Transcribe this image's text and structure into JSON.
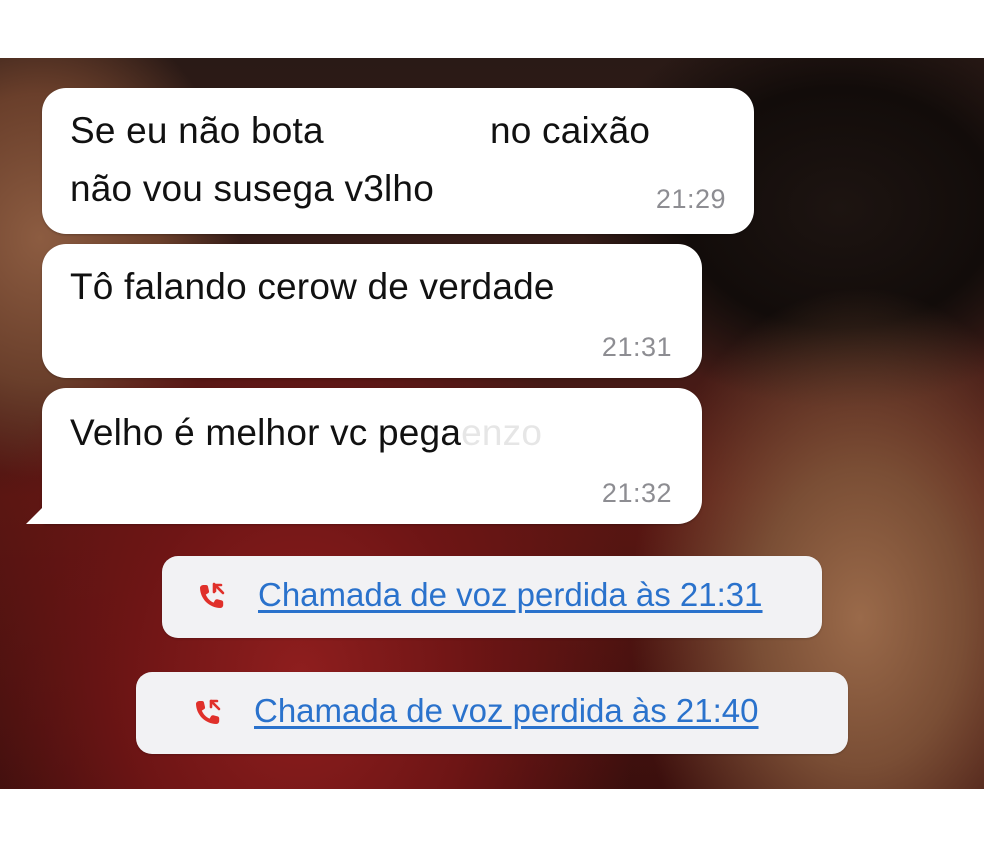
{
  "colors": {
    "bubble_bg": "#ffffff",
    "message_text": "#111111",
    "timestamp_text": "#8d8d92",
    "call_pill_bg": "#f2f2f4",
    "missed_call_link": "#2a72cc",
    "missed_call_icon": "#e0302a"
  },
  "messages": [
    {
      "line1_part1": "Se eu não bota",
      "line1_part2": "no caixão",
      "line2": "não vou susega v3lho",
      "time": "21:29"
    },
    {
      "line1": "Tô falando cerow de verdade",
      "time": "21:31"
    },
    {
      "line1": "Velho é melhor vc pega",
      "faded_word": "enzo",
      "time": "21:32"
    }
  ],
  "missed_calls": [
    {
      "icon": "missed-call-icon",
      "label": "Chamada de voz perdida às 21:31"
    },
    {
      "icon": "missed-call-icon",
      "label": "Chamada de voz perdida às 21:40"
    }
  ]
}
